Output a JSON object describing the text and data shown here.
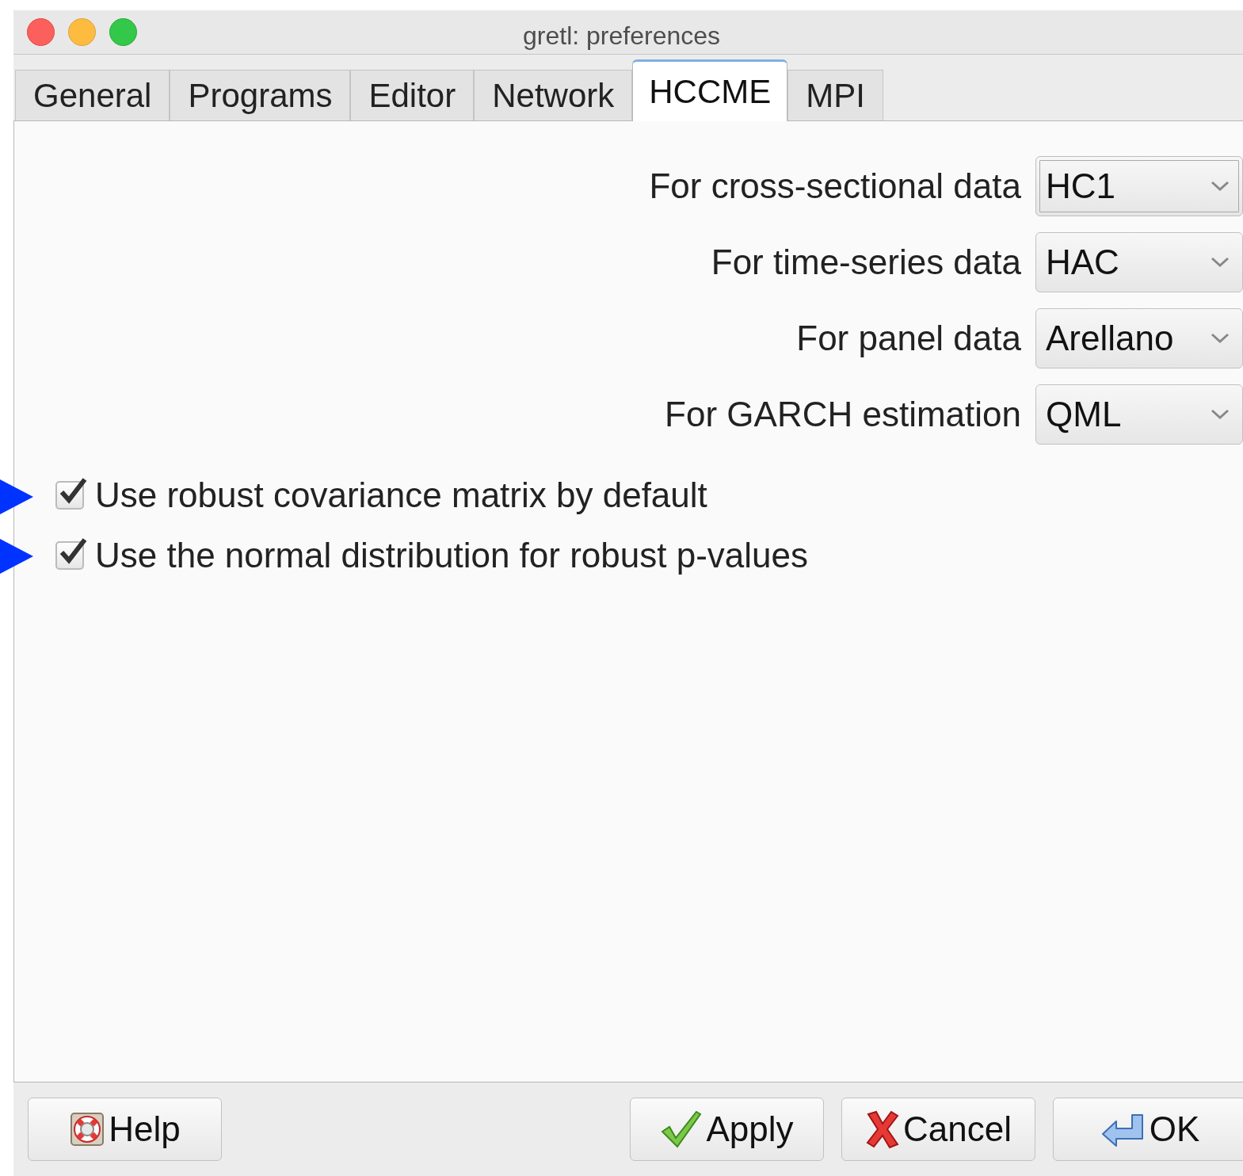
{
  "window": {
    "title": "gretl: preferences"
  },
  "tabs": [
    {
      "label": "General",
      "selected": false
    },
    {
      "label": "Programs",
      "selected": false
    },
    {
      "label": "Editor",
      "selected": false
    },
    {
      "label": "Network",
      "selected": false
    },
    {
      "label": "HCCME",
      "selected": true
    },
    {
      "label": "MPI",
      "selected": false
    }
  ],
  "settings": [
    {
      "label": "For cross-sectional data",
      "value": "HC1",
      "focused": true
    },
    {
      "label": "For time-series data",
      "value": "HAC",
      "focused": false
    },
    {
      "label": "For panel data",
      "value": "Arellano",
      "focused": false
    },
    {
      "label": "For GARCH estimation",
      "value": "QML",
      "focused": false
    }
  ],
  "checkboxes": [
    {
      "label": "Use robust covariance matrix by default",
      "checked": true,
      "marked": true
    },
    {
      "label": "Use the normal distribution for robust p-values",
      "checked": true,
      "marked": true
    }
  ],
  "buttons": [
    {
      "kind": "help",
      "label": "Help"
    },
    {
      "kind": "apply",
      "label": "Apply"
    },
    {
      "kind": "cancel",
      "label": "Cancel"
    },
    {
      "kind": "ok",
      "label": "OK"
    }
  ]
}
